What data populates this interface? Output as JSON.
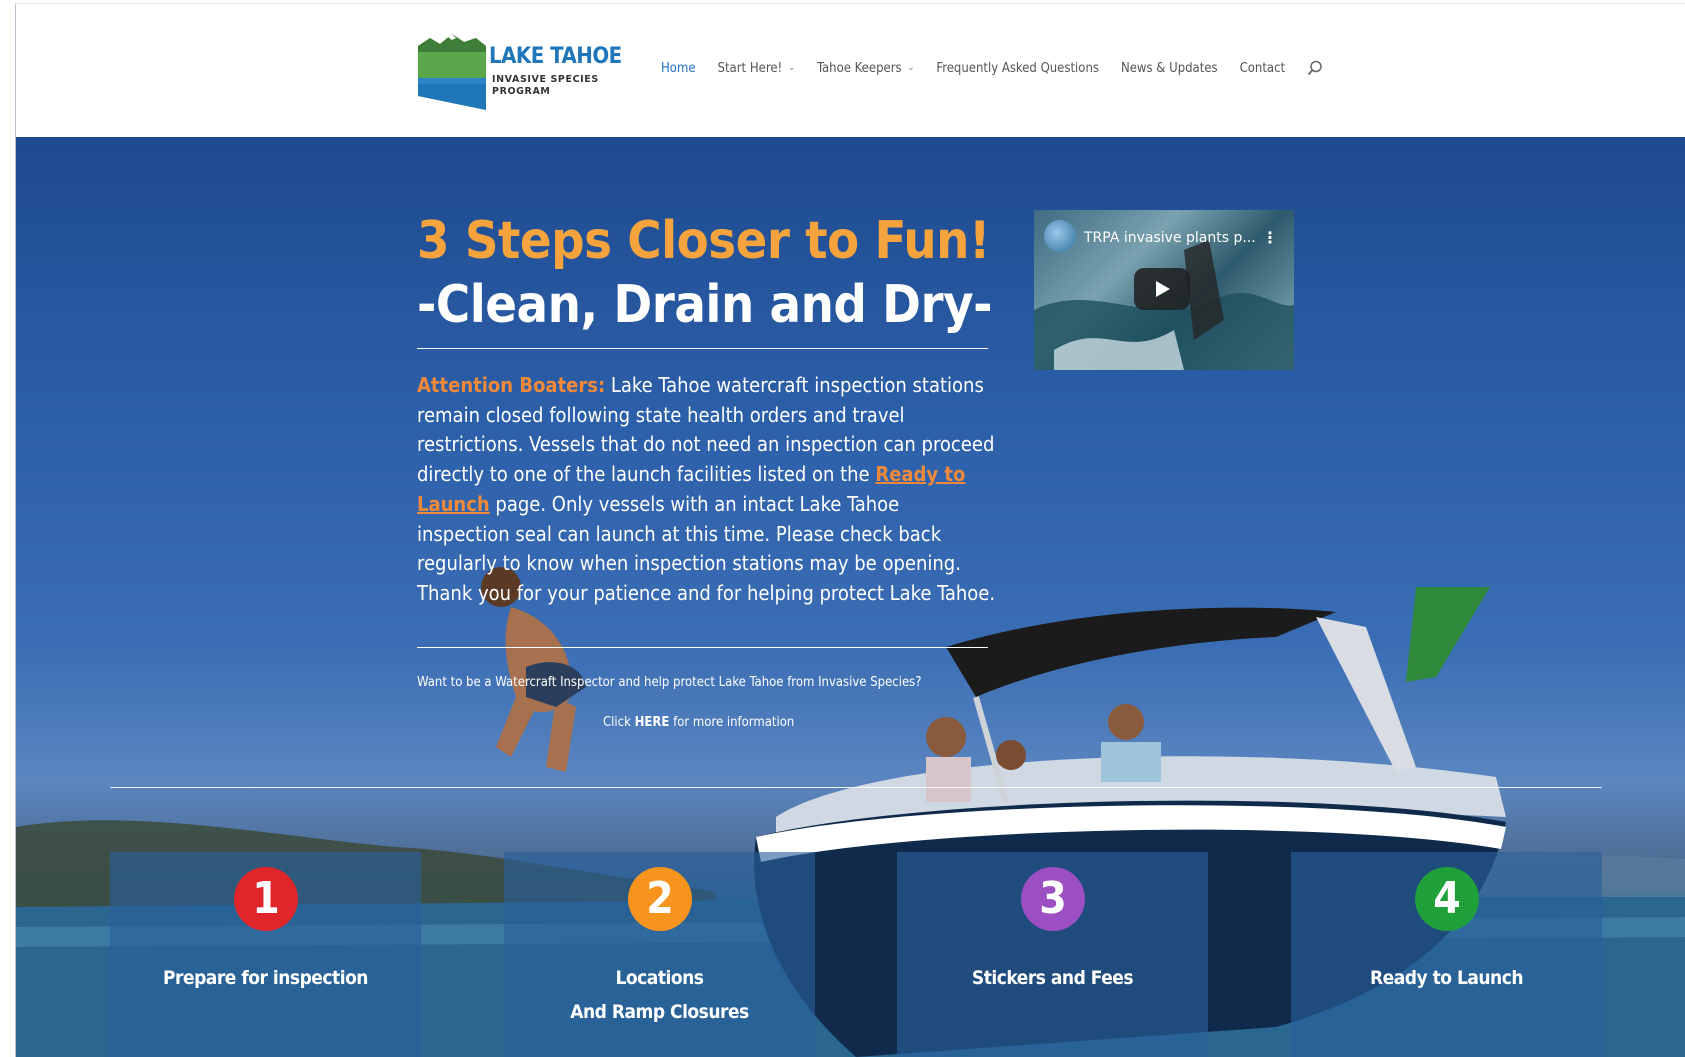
{
  "logo": {
    "title": "LAKE TAHOE",
    "subtitle_line1": "INVASIVE SPECIES",
    "subtitle_line2": "PROGRAM"
  },
  "nav": {
    "items": [
      {
        "label": "Home",
        "active": true,
        "dropdown": false
      },
      {
        "label": "Start Here!",
        "active": false,
        "dropdown": true
      },
      {
        "label": "Tahoe Keepers",
        "active": false,
        "dropdown": true
      },
      {
        "label": "Frequently Asked Questions",
        "active": false,
        "dropdown": false
      },
      {
        "label": "News & Updates",
        "active": false,
        "dropdown": false
      },
      {
        "label": "Contact",
        "active": false,
        "dropdown": false
      }
    ],
    "search_icon": "search-icon"
  },
  "hero": {
    "headline_1": "3 Steps Closer to Fun!",
    "headline_2": "-Clean, Drain and Dry-",
    "notice": {
      "attention": "Attention Boaters:",
      "text_1": " Lake Tahoe watercraft inspection stations remain closed following state health orders and travel restrictions. Vessels that do not need an inspection can proceed directly to one of the launch facilities listed on the ",
      "link": "Ready to Launch",
      "text_2": " page. Only vessels with an intact Lake Tahoe inspection seal can launch at this time. Please check back  regularly to know when inspection stations may be opening. Thank you for your patience and for helping protect Lake Tahoe."
    },
    "inspector_question": "Want to be a Watercraft Inspector and help protect Lake Tahoe from Invasive Species?",
    "click_prefix": "Click ",
    "click_link": "HERE",
    "click_suffix": " for more information"
  },
  "video": {
    "title": "TRPA invasive plants p...",
    "menu_icon": "more-vert-icon",
    "play_icon": "play-icon"
  },
  "steps": [
    {
      "number": "1",
      "label": "Prepare for inspection",
      "sub": "",
      "color": "#e0262b"
    },
    {
      "number": "2",
      "label": "Locations",
      "sub": "And Ramp Closures",
      "color": "#f7941d"
    },
    {
      "number": "3",
      "label": "Stickers and Fees",
      "sub": "",
      "color": "#9b4fc2"
    },
    {
      "number": "4",
      "label": "Ready to Launch",
      "sub": "",
      "color": "#1fa03a"
    }
  ],
  "colors": {
    "accent_orange": "#f5a43d",
    "link_blue": "#1f6fc0",
    "brand_blue": "#1f76b9",
    "brand_green": "#5aa64a"
  }
}
